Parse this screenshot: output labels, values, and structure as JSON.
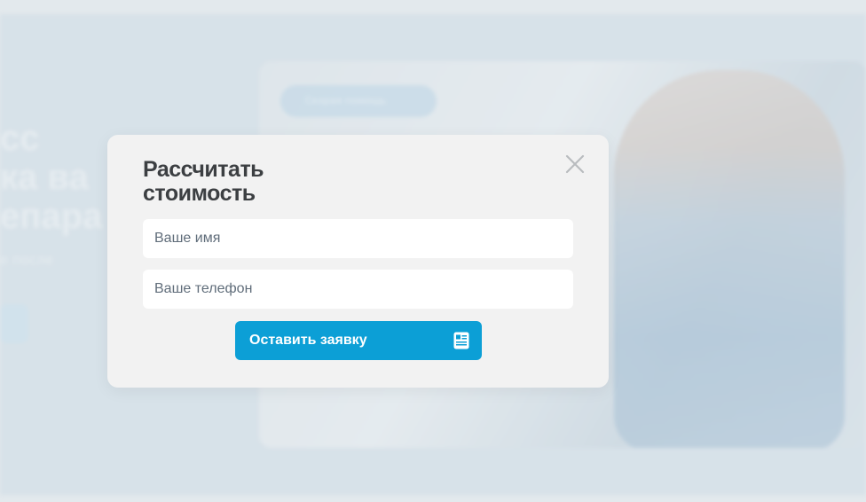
{
  "background": {
    "chip_text": "Скорая помощь",
    "hero_lines": [
      "сс",
      "ка ва",
      "епара"
    ],
    "hero_sub": "е после"
  },
  "modal": {
    "title": "Рассчитать\nстоимость",
    "name_placeholder": "Ваше имя",
    "phone_placeholder": "Ваше телефон",
    "submit_label": "Оставить заявку",
    "close_icon": "close-icon",
    "submit_icon": "form-document-icon"
  },
  "colors": {
    "accent": "#0c9fd6",
    "modal_bg": "#f2f2f2",
    "title": "#3c3f42"
  }
}
